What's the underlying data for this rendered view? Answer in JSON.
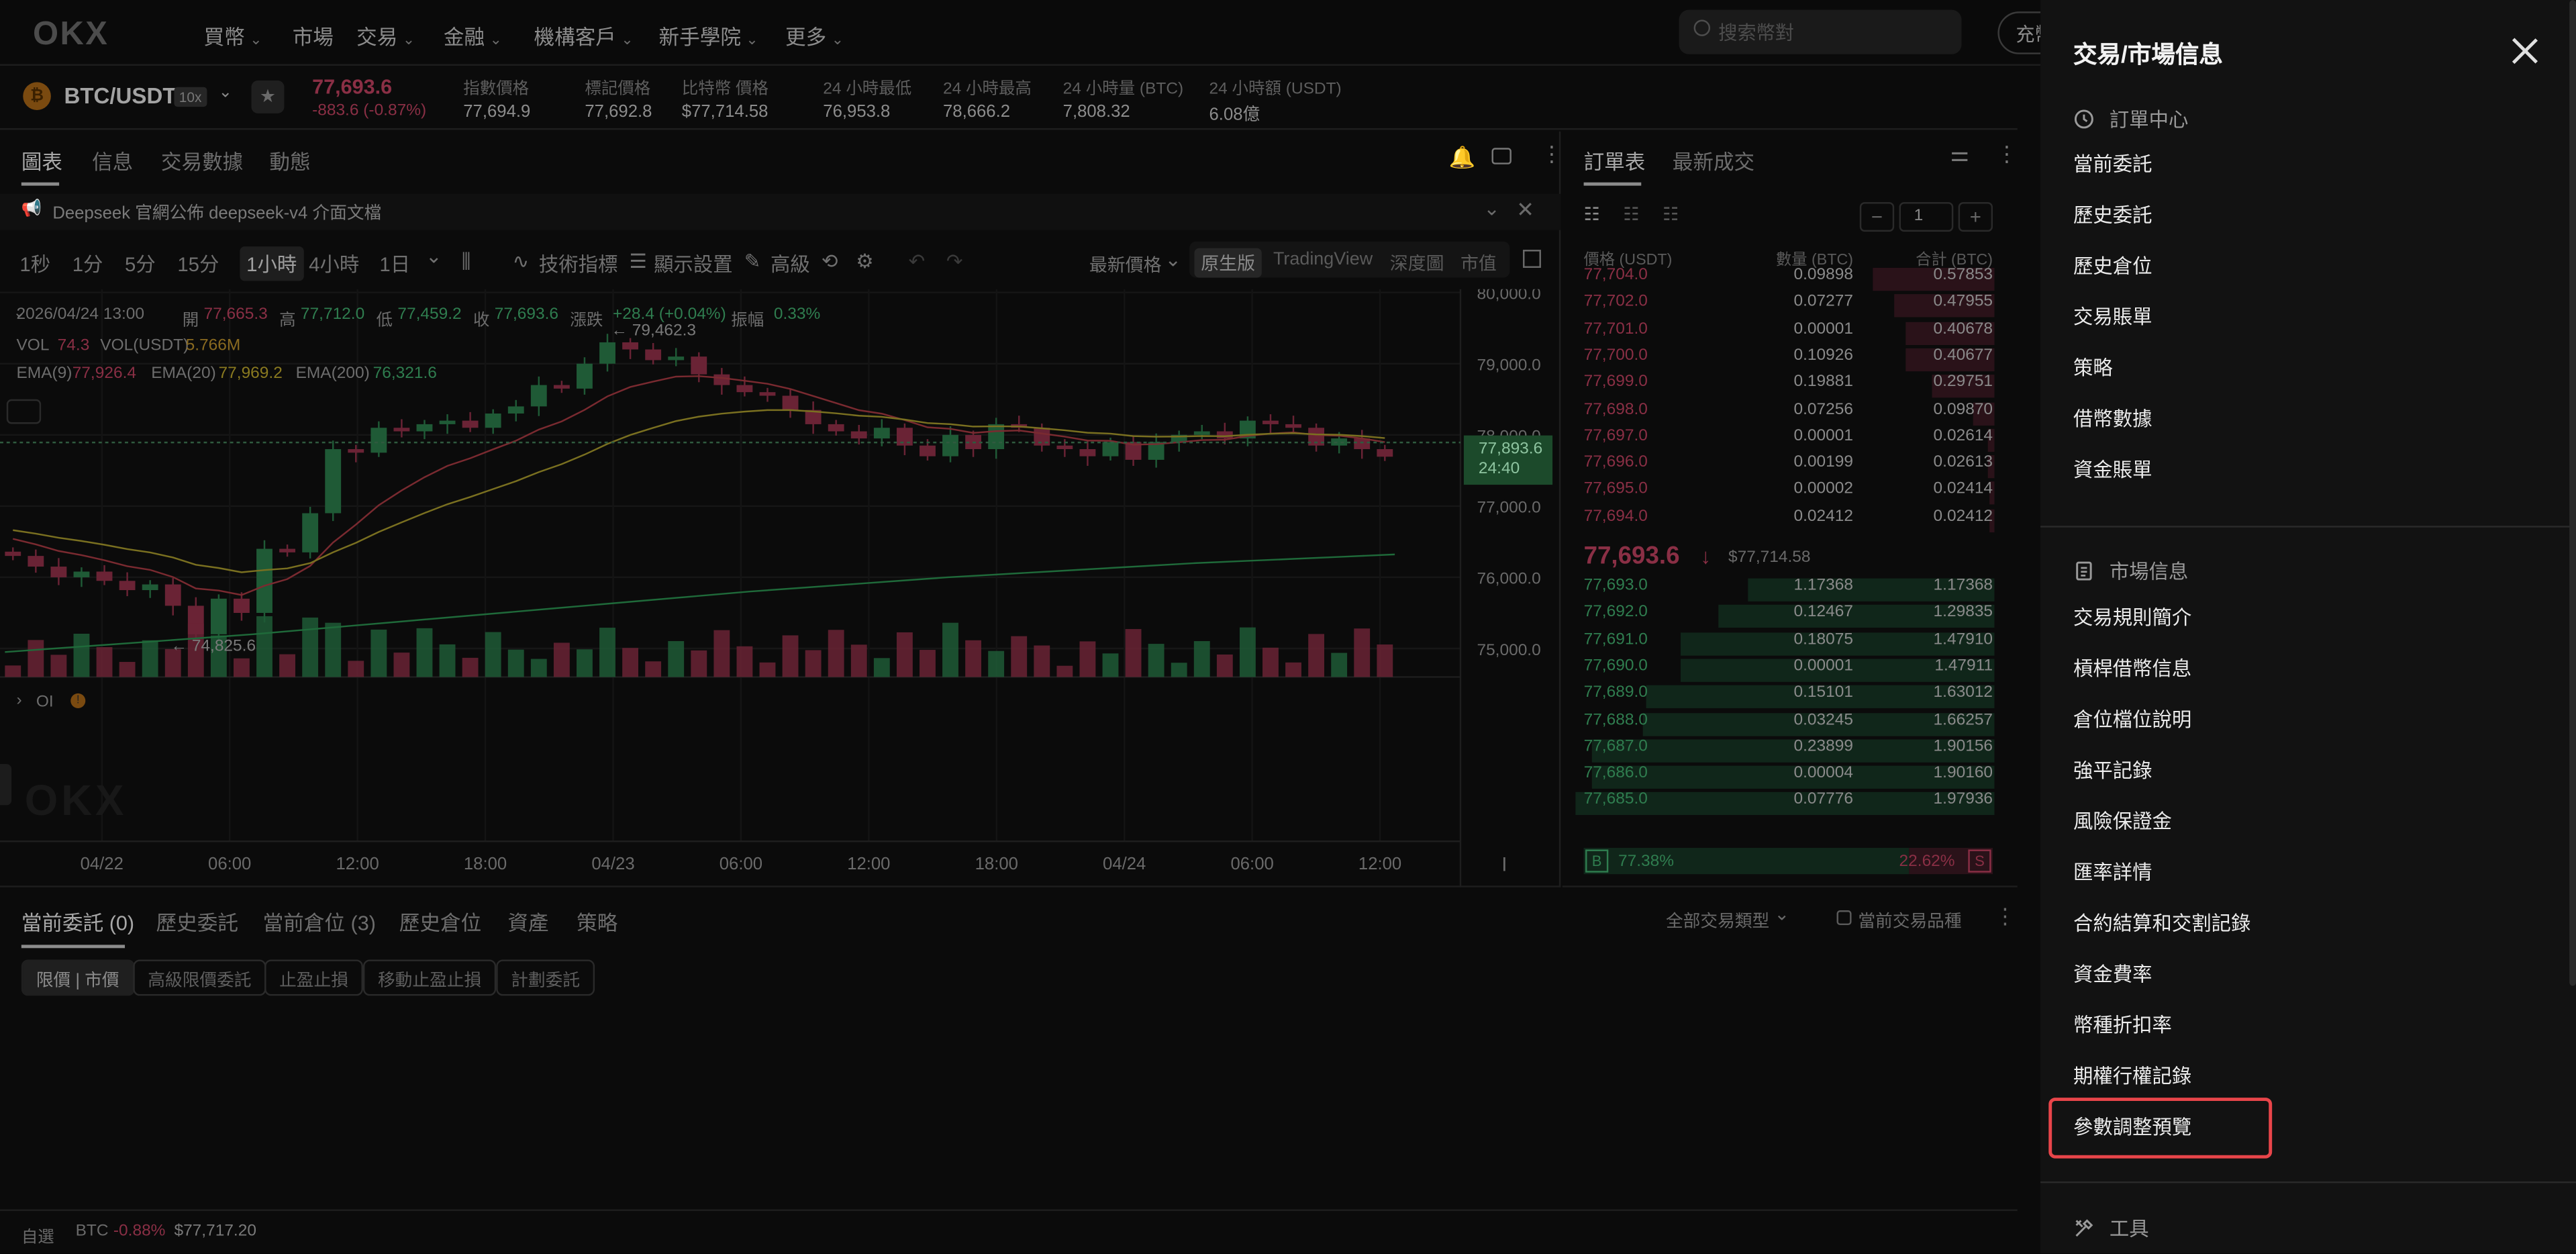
{
  "nav": {
    "logo": "OKX",
    "items": [
      {
        "label": "買幣",
        "chevron": true
      },
      {
        "label": "市場",
        "chevron": false
      },
      {
        "label": "交易",
        "chevron": true
      },
      {
        "label": "金融",
        "chevron": true
      },
      {
        "label": "機構客戶",
        "chevron": true
      },
      {
        "label": "新手學院",
        "chevron": true
      },
      {
        "label": "更多",
        "chevron": true
      }
    ],
    "search_placeholder": "搜索幣對",
    "deposit_label": "充幣"
  },
  "ticker": {
    "pair": "BTC/USDT",
    "leverage": "10x",
    "price": "77,693.6",
    "change": "-883.6 (-0.87%)",
    "stats": [
      {
        "label": "指數價格",
        "value": "77,694.9"
      },
      {
        "label": "標記價格",
        "value": "77,692.8"
      },
      {
        "label": "比特幣 價格",
        "value": "$77,714.58"
      },
      {
        "label": "24 小時最低",
        "value": "76,953.8"
      },
      {
        "label": "24 小時最高",
        "value": "78,666.2"
      },
      {
        "label": "24 小時量 (BTC)",
        "value": "7,808.32"
      },
      {
        "label": "24 小時額 (USDT)",
        "value": "6.08億"
      }
    ]
  },
  "chart_tabs": [
    "圖表",
    "信息",
    "交易數據",
    "動態"
  ],
  "notice": "Deepseek 官網公佈 deepseek-v4 介面文檔",
  "toolbar": {
    "intervals": [
      "1秒",
      "1分",
      "5分",
      "15分",
      "1小時",
      "4小時",
      "1日"
    ],
    "active_interval": "1小時",
    "indicators": "技術指標",
    "display": "顯示設置",
    "advanced": "高級",
    "price_type": "最新價格",
    "views": [
      "原生版",
      "TradingView",
      "深度圖",
      "市值"
    ]
  },
  "legend": {
    "ohlc_line": "2026/04/24 13:00",
    "open_label": "開",
    "open": "77,665.3",
    "high_label": "高",
    "high": "77,712.0",
    "low_label": "低",
    "low": "77,459.2",
    "close_label": "收",
    "close": "77,693.6",
    "chg_label": "漲跌",
    "chg": "+28.4 (+0.04%)",
    "amp_label": "振幅",
    "amp": "0.33%",
    "vol_label": "VOL",
    "vol": "74.3",
    "volu_label": "VOL(USDT)",
    "volu": "5.766M",
    "ema9_label": "EMA(9)",
    "ema9": "77,926.4",
    "ema20_label": "EMA(20)",
    "ema20": "77,969.2",
    "ema200_label": "EMA(200)",
    "ema200": "76,321.6",
    "oi_label": "OI"
  },
  "chart_data": {
    "type": "line",
    "title": "",
    "y_ticks": [
      "80,000.0",
      "79,000.0",
      "78,000.0",
      "77,000.0",
      "76,000.0",
      "75,000.0"
    ],
    "x_ticks": [
      "04/22",
      "06:00",
      "12:00",
      "18:00",
      "04/23",
      "06:00",
      "12:00",
      "18:00",
      "04/24",
      "06:00",
      "12:00"
    ],
    "ylim": [
      74600,
      80000
    ],
    "last_price": "77,893.6",
    "countdown": "24:40",
    "high_annotation": "← 79,462.3",
    "low_annotation": "← 74,825.6",
    "candles_close": [
      76300,
      76150,
      76000,
      76080,
      75950,
      75820,
      75900,
      75600,
      75200,
      75700,
      75500,
      76400,
      76350,
      76900,
      77800,
      77750,
      78100,
      78050,
      78150,
      78200,
      78100,
      78300,
      78400,
      78700,
      78650,
      79000,
      79300,
      79200,
      79050,
      79100,
      78850,
      78700,
      78600,
      78550,
      78350,
      78150,
      78050,
      77950,
      78100,
      77850,
      77700,
      78000,
      77800,
      78150,
      78100,
      77850,
      77800,
      77700,
      77900,
      77650,
      77900,
      78000,
      78050,
      77950,
      78200,
      78150,
      78100,
      77850,
      77950,
      77800,
      77693.6
    ],
    "ema200": [
      74950,
      75000,
      75050,
      75100,
      75150,
      75200,
      75260,
      75320,
      75380,
      75440,
      75500,
      75560,
      75620,
      75680,
      75740,
      75800,
      75850,
      75900,
      75950,
      76000,
      76040,
      76080,
      76120,
      76160,
      76200,
      76230,
      76260,
      76290,
      76321.6
    ]
  },
  "orderbook": {
    "tabs": [
      "訂單表",
      "最新成交"
    ],
    "headers": [
      "價格 (USDT)",
      "數量 (BTC)",
      "合計 (BTC)"
    ],
    "step": "1",
    "asks": [
      {
        "p": "77,704.0",
        "q": "0.09898",
        "t": "0.57853",
        "w": 0.29
      },
      {
        "p": "77,702.0",
        "q": "0.07277",
        "t": "0.47955",
        "w": 0.24
      },
      {
        "p": "77,701.0",
        "q": "0.00001",
        "t": "0.40678",
        "w": 0.21
      },
      {
        "p": "77,700.0",
        "q": "0.10926",
        "t": "0.40677",
        "w": 0.21
      },
      {
        "p": "77,699.0",
        "q": "0.19881",
        "t": "0.29751",
        "w": 0.15
      },
      {
        "p": "77,698.0",
        "q": "0.07256",
        "t": "0.09870",
        "w": 0.05
      },
      {
        "p": "77,697.0",
        "q": "0.00001",
        "t": "0.02614",
        "w": 0.015
      },
      {
        "p": "77,696.0",
        "q": "0.00199",
        "t": "0.02613",
        "w": 0.015
      },
      {
        "p": "77,695.0",
        "q": "0.00002",
        "t": "0.02414",
        "w": 0.013
      },
      {
        "p": "77,694.0",
        "q": "0.02412",
        "t": "0.02412",
        "w": 0.013
      }
    ],
    "mid_price": "77,693.6",
    "mid_usd": "$77,714.58",
    "bids": [
      {
        "p": "77,693.0",
        "q": "1.17368",
        "t": "1.17368",
        "w": 0.59
      },
      {
        "p": "77,692.0",
        "q": "0.12467",
        "t": "1.29835",
        "w": 0.66
      },
      {
        "p": "77,691.0",
        "q": "0.18075",
        "t": "1.47910",
        "w": 0.75
      },
      {
        "p": "77,690.0",
        "q": "0.00001",
        "t": "1.47911",
        "w": 0.75
      },
      {
        "p": "77,689.0",
        "q": "0.15101",
        "t": "1.63012",
        "w": 0.83
      },
      {
        "p": "77,688.0",
        "q": "0.03245",
        "t": "1.66257",
        "w": 0.84
      },
      {
        "p": "77,687.0",
        "q": "0.23899",
        "t": "1.90156",
        "w": 0.96
      },
      {
        "p": "77,686.0",
        "q": "0.00004",
        "t": "1.90160",
        "w": 0.96
      },
      {
        "p": "77,685.0",
        "q": "0.07776",
        "t": "1.97936",
        "w": 1.0
      }
    ],
    "buy_ratio": "77.38%",
    "sell_ratio": "22.62%",
    "b": "B",
    "s": "S"
  },
  "bottom": {
    "tabs": [
      "當前委託 (0)",
      "歷史委託",
      "當前倉位 (3)",
      "歷史倉位",
      "資產",
      "策略"
    ],
    "filter": "全部交易類型",
    "current_only": "當前交易品種",
    "chips": [
      "限價 | 市價",
      "高級限價委託",
      "止盈止損",
      "移動止盈止損",
      "計劃委託"
    ]
  },
  "statusbar": {
    "fav": "自選",
    "sym": "BTC",
    "chg": "-0.88%",
    "price": "$77,717.20"
  },
  "drawer": {
    "title": "交易/市場信息",
    "order_center": {
      "head": "訂單中心",
      "items": [
        "當前委託",
        "歷史委託",
        "歷史倉位",
        "交易賬單",
        "策略",
        "借幣數據",
        "資金賬單"
      ]
    },
    "market_info": {
      "head": "市場信息",
      "items": [
        "交易規則簡介",
        "槓桿借幣信息",
        "倉位檔位說明",
        "強平記錄",
        "風險保證金",
        "匯率詳情",
        "合約結算和交割記錄",
        "資金費率",
        "幣種折扣率",
        "期權行權記錄",
        "參數調整預覽"
      ]
    },
    "tools_head": "工具"
  },
  "colors": {
    "up": "#2f7d4f",
    "down": "#8a2f45",
    "highlight": "#e8454a",
    "drawer_bg": "#121212"
  }
}
